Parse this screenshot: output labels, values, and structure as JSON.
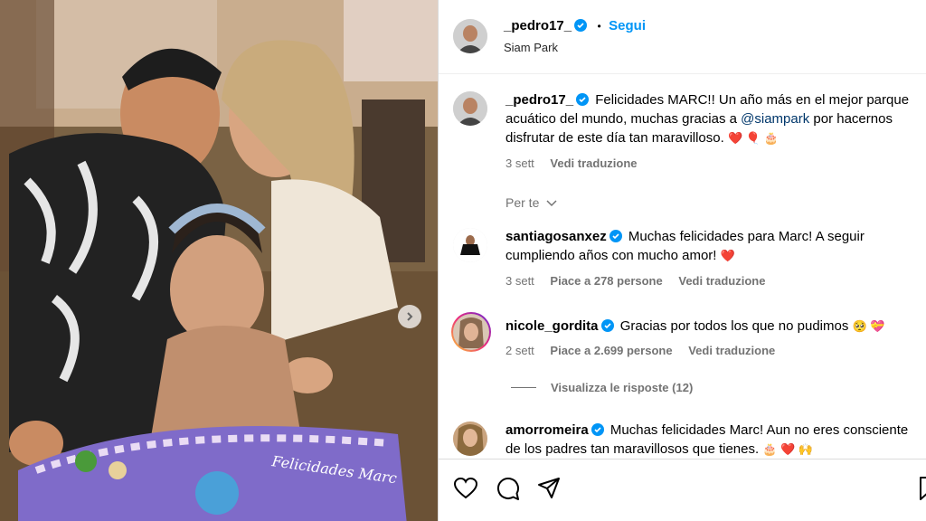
{
  "post": {
    "username": "_pedro17_",
    "location": "Siam Park",
    "follow_label": "Segui",
    "dot": "•",
    "caption_parts": [
      "Felicidades MARC!! Un año más en el mejor parque acuático del mundo, muchas gracias a ",
      "@siampark",
      " por hacernos disfrutar de este día tan maravilloso. "
    ],
    "caption_emojis": "❤️ 🎈 🎂",
    "caption_time": "3 sett",
    "caption_translate": "Vedi traduzione",
    "for_you": "Per te"
  },
  "cake_text": "Felicidades Marc",
  "comments": [
    {
      "username": "santiagosanxez",
      "text": "Muchas felicidades para Marc! A seguir cumpliendo años con mucho amor! ",
      "emojis": "❤️",
      "time": "3 sett",
      "likes": "Piace a 278 persone",
      "translate": "Vedi traduzione"
    },
    {
      "username": "nicole_gordita",
      "text": "Gracias por todos los que no pudimos ",
      "emojis": "🥺 💝",
      "time": "2 sett",
      "likes": "Piace a 2.699 persone",
      "translate": "Vedi traduzione",
      "replies": "Visualizza le risposte (12)"
    },
    {
      "username": "amorromeira",
      "text": "Muchas felicidades Marc! Aun no eres consciente de los padres tan maravillosos que tienes. ",
      "emojis": "🎂 ❤️ 🙌"
    }
  ],
  "colors": {
    "accent": "#0095f6",
    "verified": "#0095f6",
    "mention": "#00376b",
    "heart": "#ed4956"
  }
}
